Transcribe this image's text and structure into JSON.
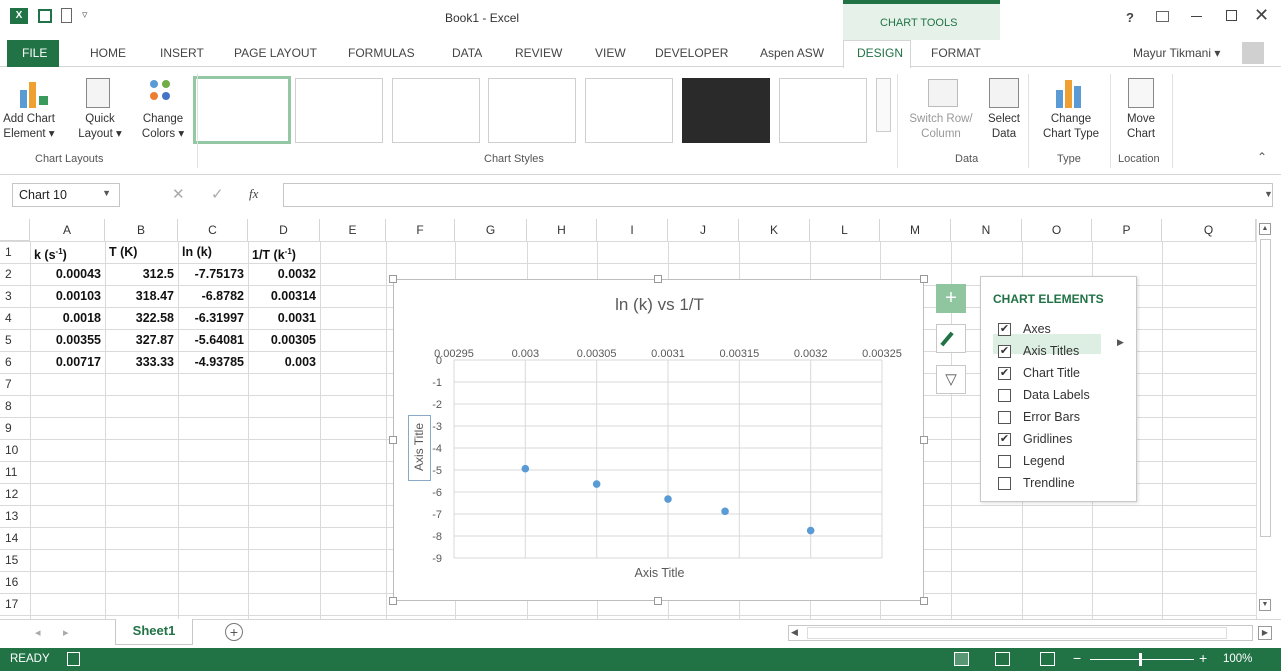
{
  "titlebar": {
    "doc_title": "Book1 - Excel",
    "context_tab": "CHART TOOLS",
    "help": "?",
    "user": "Mayur Tikmani ▾"
  },
  "tabs": [
    "FILE",
    "HOME",
    "INSERT",
    "PAGE LAYOUT",
    "FORMULAS",
    "DATA",
    "REVIEW",
    "VIEW",
    "DEVELOPER",
    "Aspen ASW",
    "DESIGN",
    "FORMAT"
  ],
  "ribbon": {
    "add_chart": [
      "Add Chart",
      "Element ▾"
    ],
    "quick": [
      "Quick",
      "Layout ▾"
    ],
    "change_colors": [
      "Change",
      "Colors ▾"
    ],
    "switch": [
      "Switch Row/",
      "Column"
    ],
    "select": [
      "Select",
      "Data"
    ],
    "change_type": [
      "Change",
      "Chart Type"
    ],
    "move": [
      "Move",
      "Chart"
    ],
    "groups": {
      "layouts": "Chart Layouts",
      "styles": "Chart Styles",
      "data": "Data",
      "type": "Type",
      "location": "Location"
    }
  },
  "formula_bar": {
    "name_box": "Chart 10",
    "fx": "fx",
    "value": ""
  },
  "columns": [
    "A",
    "B",
    "C",
    "D",
    "E",
    "F",
    "G",
    "H",
    "I",
    "J",
    "K",
    "L",
    "M",
    "N",
    "O",
    "P",
    "Q"
  ],
  "rows": [
    "1",
    "2",
    "3",
    "4",
    "5",
    "6",
    "7",
    "8",
    "9",
    "10",
    "11",
    "12",
    "13",
    "14",
    "15",
    "16",
    "17"
  ],
  "headers": {
    "a": "k (s",
    "a_sup": "-1",
    "a_end": ")",
    "b": "T (K)",
    "c": "ln (k)",
    "d": "1/T (k",
    "d_sup": "-1",
    "d_end": ")"
  },
  "table": [
    [
      "0.00043",
      "312.5",
      "-7.75173",
      "0.0032"
    ],
    [
      "0.00103",
      "318.47",
      "-6.8782",
      "0.00314"
    ],
    [
      "0.0018",
      "322.58",
      "-6.31997",
      "0.0031"
    ],
    [
      "0.00355",
      "327.87",
      "-5.64081",
      "0.00305"
    ],
    [
      "0.00717",
      "333.33",
      "-4.93785",
      "0.003"
    ]
  ],
  "chart_data": {
    "type": "scatter",
    "title": "ln (k) vs 1/T",
    "xlabel": "Axis Title",
    "ylabel": "Axis Title",
    "x_ticks": [
      "0.00295",
      "0.003",
      "0.00305",
      "0.0031",
      "0.00315",
      "0.0032",
      "0.00325"
    ],
    "y_ticks": [
      "0",
      "-1",
      "-2",
      "-3",
      "-4",
      "-5",
      "-6",
      "-7",
      "-8",
      "-9"
    ],
    "xlim": [
      0.00295,
      0.00325
    ],
    "ylim": [
      -9,
      0
    ],
    "grid": true,
    "color": "#5b9bd5",
    "points": [
      {
        "x": 0.003,
        "y": -4.93785
      },
      {
        "x": 0.00305,
        "y": -5.64081
      },
      {
        "x": 0.0031,
        "y": -6.31997
      },
      {
        "x": 0.00314,
        "y": -6.8782
      },
      {
        "x": 0.0032,
        "y": -7.75173
      }
    ]
  },
  "chart_elements": {
    "title": "CHART ELEMENTS",
    "items": [
      {
        "label": "Axes",
        "checked": true
      },
      {
        "label": "Axis Titles",
        "checked": true
      },
      {
        "label": "Chart Title",
        "checked": true
      },
      {
        "label": "Data Labels",
        "checked": false
      },
      {
        "label": "Error Bars",
        "checked": false
      },
      {
        "label": "Gridlines",
        "checked": true
      },
      {
        "label": "Legend",
        "checked": false
      },
      {
        "label": "Trendline",
        "checked": false
      }
    ],
    "check_mark": "✔"
  },
  "sheet": {
    "name": "Sheet1",
    "add": "+"
  },
  "status": {
    "ready": "READY",
    "zoom": "100%"
  },
  "colors": {
    "excel_green": "#217346",
    "selected_tab": "#217346",
    "point": "#5b9bd5"
  }
}
